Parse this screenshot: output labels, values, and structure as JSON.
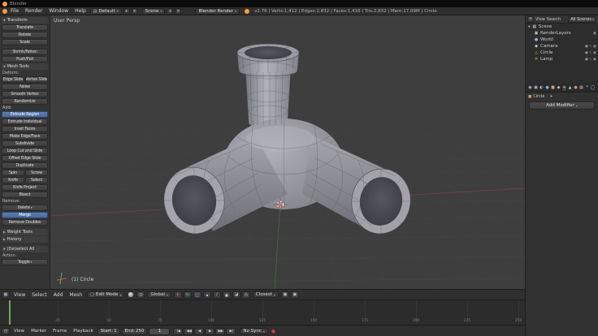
{
  "window": {
    "title": "Blender"
  },
  "info_bar": {
    "menus": [
      "File",
      "Render",
      "Window",
      "Help"
    ],
    "layout_value": "Default",
    "scene_value": "Scene",
    "engine_value": "Blender Render",
    "stats": "v2.76 | Verts:1,412 | Edges:2,832 | Faces:1,416 | Tris:2,832 | Mem:17.09M | Circle"
  },
  "icons": {
    "chevron_down": "▾",
    "triangle_down": "▼",
    "triangle_right": "▶",
    "plus": "+",
    "unlink": "×",
    "editor_info": "▤",
    "editor_3d": "▦",
    "editor_outliner": "≡",
    "mode_cube": "▢",
    "pivot": "⊙",
    "magnet": "∩",
    "camera_render": "▣",
    "translate": "+",
    "rotate": "↻",
    "scale": "◱",
    "vertex_mode": "▪",
    "edge_mode": "∕",
    "face_mode": "■",
    "occlude": "◪",
    "clock": "◷",
    "breadcrumb_sep": "›",
    "modifier": "+"
  },
  "tool_shelf": {
    "items": [
      {
        "t": "header",
        "label": "Transform",
        "open": true
      },
      {
        "t": "btn",
        "label": "Translate"
      },
      {
        "t": "btn",
        "label": "Rotate"
      },
      {
        "t": "btn",
        "label": "Scale"
      },
      {
        "t": "gap"
      },
      {
        "t": "btn",
        "label": "Shrink/Fatten"
      },
      {
        "t": "btn",
        "label": "Push/Pull"
      },
      {
        "t": "header",
        "label": "Mesh Tools",
        "open": true
      },
      {
        "t": "label",
        "label": "Deform:"
      },
      {
        "t": "row",
        "items": [
          "Edge Slide",
          "Vertex Slide"
        ]
      },
      {
        "t": "btn",
        "label": "Noise"
      },
      {
        "t": "btn",
        "label": "Smooth Vertex"
      },
      {
        "t": "btn",
        "label": "Randomize"
      },
      {
        "t": "label",
        "label": "Add:"
      },
      {
        "t": "btn",
        "label": "Extrude Region",
        "active": true
      },
      {
        "t": "btn",
        "label": "Extrude Individual"
      },
      {
        "t": "btn",
        "label": "Inset Faces"
      },
      {
        "t": "btn",
        "label": "Make Edge/Face"
      },
      {
        "t": "btn",
        "label": "Subdivide"
      },
      {
        "t": "btn",
        "label": "Loop Cut and Slide"
      },
      {
        "t": "btn",
        "label": "Offset Edge Slide"
      },
      {
        "t": "btn",
        "label": "Duplicate"
      },
      {
        "t": "row",
        "items": [
          "Spin",
          "Screw"
        ]
      },
      {
        "t": "row",
        "items": [
          "Knife",
          "Select"
        ]
      },
      {
        "t": "btn",
        "label": "Knife Project"
      },
      {
        "t": "btn",
        "label": "Bisect"
      },
      {
        "t": "label",
        "label": "Remove:"
      },
      {
        "t": "btn",
        "label": "Delete",
        "dropdown": true
      },
      {
        "t": "btn",
        "label": "Merge",
        "active": true
      },
      {
        "t": "btn",
        "label": "Remove Doubles"
      },
      {
        "t": "gap"
      },
      {
        "t": "header",
        "label": "Weight Tools",
        "open": false
      },
      {
        "t": "header",
        "label": "History",
        "open": false
      },
      {
        "t": "gap"
      },
      {
        "t": "header",
        "label": "(De)select All",
        "open": true
      },
      {
        "t": "label",
        "label": "Action:"
      },
      {
        "t": "btn",
        "label": "Toggle",
        "dropdown": true
      }
    ]
  },
  "viewport": {
    "view_label": "User Persp",
    "object_label": "(1) Circle",
    "header": {
      "menus": [
        "View",
        "Select",
        "Add",
        "Mesh"
      ],
      "mode": "Edit Mode",
      "orientation": "Global",
      "snap_target": "Closest"
    }
  },
  "timeline": {
    "menus": [
      "View",
      "Marker",
      "Frame",
      "Playback"
    ],
    "start_label": "Start:",
    "start_value": "1",
    "end_label": "End:",
    "end_value": "250",
    "frame_value": "1",
    "sync_value": "No Sync",
    "frame_start": 0,
    "frame_end": 250,
    "current_frame": 1,
    "tick_frames": [
      25,
      50,
      75,
      100,
      125,
      150,
      175,
      200,
      225,
      250
    ],
    "transport": [
      {
        "name": "jump-to-start-button",
        "glyph": "|◀"
      },
      {
        "name": "jump-prev-keyframe-button",
        "glyph": "◀◀"
      },
      {
        "name": "play-reverse-button",
        "glyph": "◀"
      },
      {
        "name": "play-button",
        "glyph": "▶"
      },
      {
        "name": "jump-next-keyframe-button",
        "glyph": "▶▶"
      },
      {
        "name": "jump-to-end-button",
        "glyph": "▶|"
      }
    ]
  },
  "outliner": {
    "menus": [
      "View",
      "Search"
    ],
    "display_mode": "All Scenes",
    "rows": [
      {
        "label": "Scene",
        "icon": "scene-icon",
        "glyph": "▦",
        "color": "#c8c8c8",
        "depth": 0,
        "disclosure": true
      },
      {
        "label": "RenderLayers",
        "icon": "renderlayers-icon",
        "glyph": "▣",
        "color": "#c8c8c8",
        "depth": 1,
        "trail": [
          "render"
        ]
      },
      {
        "label": "World",
        "icon": "world-icon",
        "glyph": "●",
        "color": "#8fb7dd",
        "depth": 1,
        "trail": []
      },
      {
        "label": "Camera",
        "icon": "camera-icon",
        "glyph": "◆",
        "color": "#c8c8c8",
        "depth": 1,
        "trail": [
          "visible",
          "selectable",
          "render"
        ]
      },
      {
        "label": "Circle",
        "icon": "mesh-object-icon",
        "glyph": "△",
        "color": "#e2a15c",
        "depth": 1,
        "trail": [
          "visible",
          "selectable",
          "render"
        ]
      },
      {
        "label": "Lamp",
        "icon": "lamp-icon",
        "glyph": "☼",
        "color": "#e8e0a8",
        "depth": 1,
        "trail": [
          "visible",
          "selectable",
          "render"
        ]
      }
    ]
  },
  "properties": {
    "tabs": [
      {
        "name": "render",
        "glyph": "◉",
        "color": "#c8c8c8"
      },
      {
        "name": "render-layers",
        "glyph": "▣",
        "color": "#c8c8c8"
      },
      {
        "name": "scene",
        "glyph": "◐",
        "color": "#c8c8c8"
      },
      {
        "name": "world",
        "glyph": "●",
        "color": "#86aed4"
      },
      {
        "name": "object",
        "glyph": "■",
        "color": "#e0a060"
      },
      {
        "name": "constraints",
        "glyph": "◆",
        "color": "#a8c0dc"
      },
      {
        "name": "modifiers",
        "glyph": "+",
        "color": "#bcd2e4",
        "active": true
      },
      {
        "name": "object-data",
        "glyph": "▲",
        "color": "#8fcf8f"
      },
      {
        "name": "material",
        "glyph": "●",
        "color": "#d08f8f"
      },
      {
        "name": "texture",
        "glyph": "▦",
        "color": "#d0b08f"
      },
      {
        "name": "particles",
        "glyph": "*",
        "color": "#c8c8c8"
      },
      {
        "name": "physics",
        "glyph": "◯",
        "color": "#8fd0d0"
      }
    ],
    "breadcrumb_object": "Circle",
    "add_modifier_label": "Add Modifier"
  },
  "colors": {
    "active_tool": "#4f74a8",
    "current_frame": "#71a84f",
    "record": "#c03030",
    "object_accent": "#e2a15c"
  }
}
